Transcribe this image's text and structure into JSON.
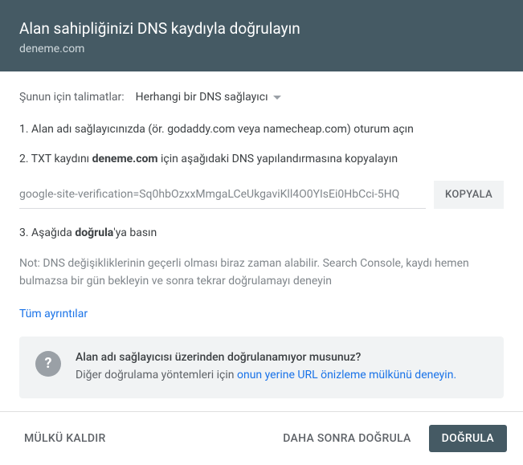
{
  "header": {
    "title": "Alan sahipliğinizi DNS kaydıyla doğrulayın",
    "domain": "deneme.com"
  },
  "instructions": {
    "label": "Şunun için talimatlar:",
    "provider": "Herhangi bir DNS sağlayıcı"
  },
  "step1": "1. Alan adı sağlayıcınızda (ör. godaddy.com veya namecheap.com) oturum açın",
  "step2_prefix": "2. TXT kaydını ",
  "step2_domain": "deneme.com",
  "step2_suffix": " için aşağıdaki DNS yapılandırmasına kopyalayın",
  "txt_record": "google-site-verification=Sq0hbOzxxMmgaLCeUkgaviKll4O0YIsEi0HbCci-5HQ",
  "copy_label": "KOPYALA",
  "step3_prefix": "3. Aşağıda ",
  "step3_bold": "doğrula",
  "step3_suffix": "'ya basın",
  "note": "Not: DNS değişikliklerinin geçerli olması biraz zaman alabilir. Search Console, kaydı hemen bulmazsa bir gün bekleyin ve sonra tekrar doğrulamayı deneyin",
  "details_link": "Tüm ayrıntılar",
  "info": {
    "icon": "?",
    "title": "Alan adı sağlayıcısı üzerinden doğrulanamıyor musunuz?",
    "desc_prefix": "Diğer doğrulama yöntemleri için ",
    "desc_link": "onun yerine URL önizleme mülkünü deneyin."
  },
  "footer": {
    "remove": "MÜLKÜ KALDIR",
    "later": "DAHA SONRA DOĞRULA",
    "verify": "DOĞRULA"
  }
}
